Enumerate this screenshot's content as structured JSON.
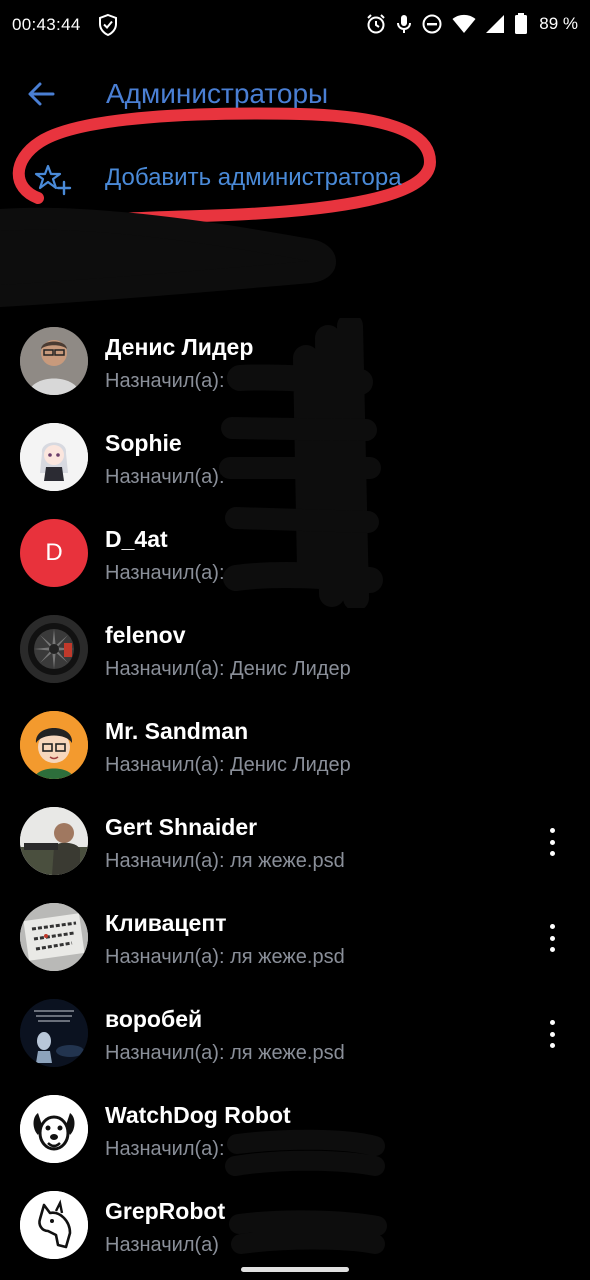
{
  "status_bar": {
    "time": "00:43:44",
    "battery_percent": "89 %",
    "icons": [
      "shield-icon",
      "alarm-icon",
      "mic-icon",
      "do-not-disturb-icon",
      "wifi-icon",
      "signal-icon",
      "battery-icon"
    ]
  },
  "header": {
    "title": "Администраторы",
    "back_icon": "arrow-left-icon",
    "accent_color": "#4a7fd4"
  },
  "add_admin": {
    "label": "Добавить администратора",
    "icon": "star-shield-add-icon"
  },
  "admins": [
    {
      "name": "Денис Лидер",
      "prefix": "Назначил(а):",
      "by": "",
      "avatar": "photo",
      "menu": false
    },
    {
      "name": "Sophie",
      "prefix": "Назначил(а):",
      "by": "",
      "avatar": "anime",
      "menu": false
    },
    {
      "name": "D_4at",
      "prefix": "Назначил(а):",
      "by": "",
      "avatar": "letter",
      "letter": "D",
      "avatar_color": "#e8323c",
      "menu": false
    },
    {
      "name": "felenov",
      "prefix": "Назначил(а):",
      "by": "Денис Лидер",
      "avatar": "wheel",
      "menu": false
    },
    {
      "name": "Mr. Sandman",
      "prefix": "Назначил(а):",
      "by": "Денис Лидер",
      "avatar": "cartoon",
      "menu": false
    },
    {
      "name": "Gert Shnaider",
      "prefix": "Назначил(а):",
      "by": "ля жеже.psd",
      "avatar": "photo2",
      "menu": true
    },
    {
      "name": "Кливацепт",
      "prefix": "Назначил(а):",
      "by": "ля жеже.psd",
      "avatar": "sign",
      "menu": true
    },
    {
      "name": "воробей",
      "prefix": "Назначил(а):",
      "by": "ля жеже.psd",
      "avatar": "alien",
      "menu": true
    },
    {
      "name": "WatchDog Robot",
      "prefix": "Назначил(а):",
      "by": "",
      "avatar": "dog",
      "menu": false
    },
    {
      "name": "GrepRobot",
      "prefix": "Назначил(а)",
      "by": "",
      "avatar": "horse",
      "menu": false
    }
  ]
}
